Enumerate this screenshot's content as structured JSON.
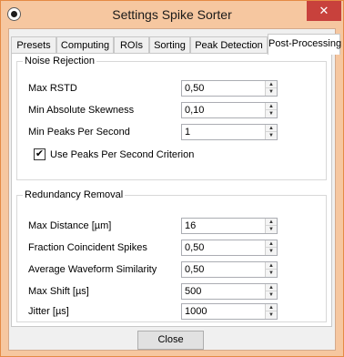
{
  "window": {
    "title": "Settings Spike Sorter",
    "close_glyph": "✕",
    "app_icon": "app-circle-icon"
  },
  "tabs": [
    {
      "label": "Presets"
    },
    {
      "label": "Computing"
    },
    {
      "label": "ROIs"
    },
    {
      "label": "Sorting"
    },
    {
      "label": "Peak Detection"
    },
    {
      "label": "Post-Processing",
      "active": true
    }
  ],
  "noise_rejection": {
    "title": "Noise Rejection",
    "fields": [
      {
        "label": "Max RSTD",
        "value": "0,50"
      },
      {
        "label": "Min Absolute Skewness",
        "value": "0,10"
      },
      {
        "label": "Min Peaks Per Second",
        "value": "1"
      }
    ],
    "checkbox": {
      "label": "Use Peaks Per Second Criterion",
      "checked": true,
      "glyph": "✔"
    }
  },
  "redundancy_removal": {
    "title": "Redundancy Removal",
    "fields": [
      {
        "label": "Max Distance [µm]",
        "value": "16"
      },
      {
        "label": "Fraction Coincident Spikes",
        "value": "0,50"
      },
      {
        "label": "Average Waveform Similarity",
        "value": "0,50"
      },
      {
        "label": "Max Shift [µs]",
        "value": "500"
      },
      {
        "label": "Jitter [µs]",
        "value": "1000"
      }
    ]
  },
  "spin_glyphs": {
    "up": "▲",
    "down": "▼"
  },
  "footer": {
    "close_label": "Close"
  }
}
